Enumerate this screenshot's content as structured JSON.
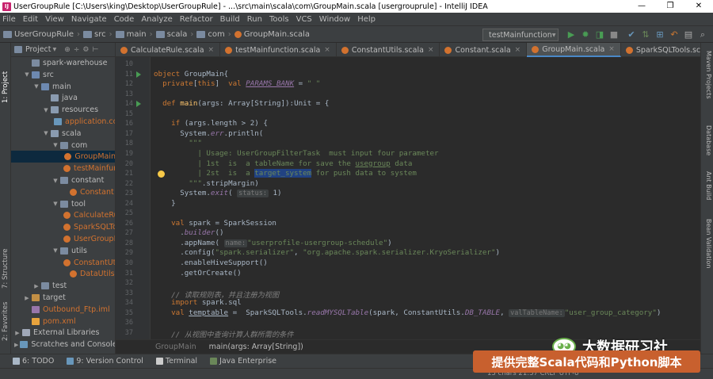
{
  "window": {
    "title": "UserGroupRule [C:\\Users\\king\\Desktop\\UserGroupRule] - ...\\src\\main\\scala\\com\\GroupMain.scala [usergrouprule] - IntelliJ IDEA",
    "controls": [
      "—",
      "❐",
      "✕"
    ]
  },
  "menu": [
    "File",
    "Edit",
    "View",
    "Navigate",
    "Code",
    "Analyze",
    "Refactor",
    "Build",
    "Run",
    "Tools",
    "VCS",
    "Window",
    "Help"
  ],
  "breadcrumb": [
    "UserGroupRule",
    "src",
    "main",
    "scala",
    "com",
    "GroupMain.scala"
  ],
  "run_config": "testMainfunction",
  "toolbar_icons": [
    "run-icon",
    "debug-icon",
    "coverage-icon",
    "profile-icon",
    "stop-icon",
    "build-icon",
    "vcs-icon",
    "structure-icon",
    "back-icon",
    "settings-icon"
  ],
  "left_tool_windows": [
    "1: Project",
    "7: Structure",
    "2: Favorites"
  ],
  "right_tool_windows": [
    "Maven Projects",
    "Database",
    "Ant Build",
    "Bean Validation"
  ],
  "project": {
    "header": "Project",
    "items": [
      {
        "label": "spark-warehouse",
        "indent": 1,
        "kind": "folder",
        "arrow": "",
        "color": "#bbbbbb"
      },
      {
        "label": "src",
        "indent": 1,
        "kind": "folder",
        "arrow": "▼",
        "color": "#bbbbbb"
      },
      {
        "label": "main",
        "indent": 2,
        "kind": "folder",
        "arrow": "▼",
        "color": "#bbbbbb"
      },
      {
        "label": "java",
        "indent": 3,
        "kind": "folder",
        "arrow": "",
        "color": "#bbbbbb"
      },
      {
        "label": "resources",
        "indent": 3,
        "kind": "folder",
        "arrow": "▼",
        "color": "#bbbbbb"
      },
      {
        "label": "application.conf",
        "indent": 4,
        "kind": "cfg",
        "arrow": "",
        "color": "#d2722f"
      },
      {
        "label": "scala",
        "indent": 3,
        "kind": "folder",
        "arrow": "▼",
        "color": "#bbbbbb"
      },
      {
        "label": "com",
        "indent": 4,
        "kind": "folder",
        "arrow": "▼",
        "color": "#bbbbbb"
      },
      {
        "label": "GroupMain",
        "indent": 5,
        "kind": "scala",
        "arrow": "",
        "color": "#d2722f",
        "selected": true
      },
      {
        "label": "testMainfunction",
        "indent": 5,
        "kind": "scala",
        "arrow": "",
        "color": "#d2722f"
      },
      {
        "label": "constant",
        "indent": 4,
        "kind": "folder",
        "arrow": "▼",
        "color": "#bbbbbb"
      },
      {
        "label": "Constant",
        "indent": 5,
        "kind": "scala",
        "arrow": "",
        "color": "#d2722f"
      },
      {
        "label": "tool",
        "indent": 4,
        "kind": "folder",
        "arrow": "▼",
        "color": "#bbbbbb"
      },
      {
        "label": "CalculateRule",
        "indent": 5,
        "kind": "scala",
        "arrow": "",
        "color": "#d2722f"
      },
      {
        "label": "SparkSQLTools",
        "indent": 5,
        "kind": "scala",
        "arrow": "",
        "color": "#d2722f"
      },
      {
        "label": "UserGroupRule",
        "indent": 5,
        "kind": "scala",
        "arrow": "",
        "color": "#d2722f"
      },
      {
        "label": "utils",
        "indent": 4,
        "kind": "folder",
        "arrow": "▼",
        "color": "#bbbbbb"
      },
      {
        "label": "ConstantUtils",
        "indent": 5,
        "kind": "scala",
        "arrow": "",
        "color": "#d2722f"
      },
      {
        "label": "DataUtils",
        "indent": 5,
        "kind": "scala",
        "arrow": "",
        "color": "#d2722f"
      },
      {
        "label": "test",
        "indent": 2,
        "kind": "folder",
        "arrow": "▶",
        "color": "#bbbbbb"
      },
      {
        "label": "target",
        "indent": 1,
        "kind": "folder",
        "arrow": "▶",
        "color": "#bbbbbb"
      },
      {
        "label": "Outbound_Ftp.iml",
        "indent": 1,
        "kind": "iml",
        "arrow": "",
        "color": "#d2722f"
      },
      {
        "label": "pom.xml",
        "indent": 1,
        "kind": "xml",
        "arrow": "",
        "color": "#d2722f"
      },
      {
        "label": "External Libraries",
        "indent": 0,
        "kind": "lib",
        "arrow": "▶",
        "color": "#bbbbbb"
      },
      {
        "label": "Scratches and Consoles",
        "indent": 0,
        "kind": "scratch",
        "arrow": "▶",
        "color": "#bbbbbb"
      }
    ]
  },
  "tabs": [
    {
      "label": "CalculateRule.scala",
      "active": false
    },
    {
      "label": "testMainfunction.scala",
      "active": false
    },
    {
      "label": "ConstantUtils.scala",
      "active": false
    },
    {
      "label": "Constant.scala",
      "active": false
    },
    {
      "label": "GroupMain.scala",
      "active": true
    },
    {
      "label": "SparkSQLTools.scala",
      "active": false
    }
  ],
  "code": {
    "lines": [
      {
        "n": "10",
        "segs": []
      },
      {
        "n": "11",
        "segs": [
          [
            "kw",
            "object "
          ],
          [
            "",
            "GroupMain{"
          ]
        ]
      },
      {
        "n": "12",
        "segs": [
          [
            "",
            "  "
          ],
          [
            "kw",
            "private"
          ],
          [
            "",
            "["
          ],
          [
            "kw",
            "this"
          ],
          [
            "",
            "]  "
          ],
          [
            "kw",
            "val "
          ],
          [
            "it und",
            "PARAMS_BANK"
          ],
          [
            "",
            " = "
          ],
          [
            "str",
            "\" \""
          ]
        ]
      },
      {
        "n": "13",
        "segs": []
      },
      {
        "n": "14",
        "segs": [
          [
            "",
            "  "
          ],
          [
            "kw",
            "def "
          ],
          [
            "fn",
            "main"
          ],
          [
            "",
            "(args: Array["
          ],
          [
            "",
            "String"
          ],
          [
            "",
            "]):"
          ],
          [
            "",
            "Unit"
          ],
          [
            "",
            " = {"
          ]
        ]
      },
      {
        "n": "15",
        "segs": []
      },
      {
        "n": "16",
        "segs": [
          [
            "",
            "    "
          ],
          [
            "kw",
            "if "
          ],
          [
            "",
            "(args.length > 2) {"
          ]
        ]
      },
      {
        "n": "17",
        "segs": [
          [
            "",
            "      System."
          ],
          [
            "it",
            "err"
          ],
          [
            "",
            ".println("
          ]
        ]
      },
      {
        "n": "18",
        "segs": [
          [
            "",
            "        "
          ],
          [
            "str",
            "\"\"\""
          ]
        ]
      },
      {
        "n": "19",
        "segs": [
          [
            "str",
            "          | Usage: UserGroupFilterTask  must input four parameter"
          ]
        ]
      },
      {
        "n": "20",
        "segs": [
          [
            "str",
            "          | 1st  is  a tableName for save the "
          ],
          [
            "str und",
            "usegroup"
          ],
          [
            "str",
            " data"
          ]
        ]
      },
      {
        "n": "21",
        "segs": [
          [
            "str",
            "          | 2st  is  a "
          ],
          [
            "str selx",
            "target_system"
          ],
          [
            "str",
            " for push data to system"
          ]
        ]
      },
      {
        "n": "22",
        "segs": [
          [
            "",
            "        "
          ],
          [
            "str",
            "\"\"\""
          ],
          [
            "",
            ".stripMargin)"
          ]
        ]
      },
      {
        "n": "23",
        "segs": [
          [
            "",
            "      System."
          ],
          [
            "it",
            "exit"
          ],
          [
            "",
            "( "
          ],
          [
            "hint",
            "status:"
          ],
          [
            "",
            " 1)"
          ]
        ]
      },
      {
        "n": "24",
        "segs": [
          [
            "",
            "    }"
          ]
        ]
      },
      {
        "n": "25",
        "segs": []
      },
      {
        "n": "26",
        "segs": [
          [
            "",
            "    "
          ],
          [
            "kw",
            "val "
          ],
          [
            "",
            "spark = SparkSession"
          ]
        ]
      },
      {
        "n": "27",
        "segs": [
          [
            "",
            "      ."
          ],
          [
            "it",
            "builder"
          ],
          [
            "",
            "()"
          ]
        ]
      },
      {
        "n": "28",
        "segs": [
          [
            "",
            "      .appName( "
          ],
          [
            "hint",
            "name:"
          ],
          [
            " ",
            ""
          ],
          [
            "str",
            "\"userprofile-usergroup-schedule\""
          ],
          [
            "",
            ")"
          ]
        ]
      },
      {
        "n": "29",
        "segs": [
          [
            "",
            "      .config("
          ],
          [
            "str",
            "\"spark.serializer\""
          ],
          [
            "",
            ", "
          ],
          [
            "str",
            "\"org.apache.spark.serializer.KryoSerializer\""
          ],
          [
            "",
            ")"
          ]
        ]
      },
      {
        "n": "30",
        "segs": [
          [
            "",
            "      .enableHiveSupport()"
          ]
        ]
      },
      {
        "n": "31",
        "segs": [
          [
            "",
            "      .getOrCreate()"
          ]
        ]
      },
      {
        "n": "32",
        "segs": []
      },
      {
        "n": "33",
        "segs": [
          [
            "cm",
            "    // 读取规则表，并且注册为视图"
          ]
        ]
      },
      {
        "n": "34",
        "segs": [
          [
            "",
            "    "
          ],
          [
            "kw",
            "import "
          ],
          [
            "",
            "spark.sql"
          ]
        ]
      },
      {
        "n": "35",
        "segs": [
          [
            "",
            "    "
          ],
          [
            "kw",
            "val "
          ],
          [
            "und",
            "temptable"
          ],
          [
            "",
            " =  SparkSQLTools."
          ],
          [
            "it",
            "readMYSQLTable"
          ],
          [
            "",
            "(spark, ConstantUtils."
          ],
          [
            "it",
            "DB_TABLE"
          ],
          [
            "",
            ", "
          ],
          [
            "hint",
            "valTableName:"
          ],
          [
            " ",
            ""
          ],
          [
            "str",
            "\"user_group_category\""
          ],
          [
            "",
            ")"
          ]
        ]
      },
      {
        "n": "36",
        "segs": []
      },
      {
        "n": "37",
        "segs": [
          [
            "cm",
            "    // 从视图中查询计算人群所需的条件"
          ]
        ]
      }
    ]
  },
  "editor_breadcrumb": [
    "GroupMain",
    "main(args: Array[String])"
  ],
  "bottom_tools": [
    {
      "label": "6: TODO",
      "icon": "todo-icon",
      "color": "#a9b7c6"
    },
    {
      "label": "9: Version Control",
      "icon": "vcs-icon",
      "color": "#6897bb"
    },
    {
      "label": "Terminal",
      "icon": "terminal-icon",
      "color": "#cccccc"
    },
    {
      "label": "Java Enterprise",
      "icon": "java-enterprise-icon",
      "color": "#6a8759"
    }
  ],
  "status": "13 chars   21:37   CRLF   UTF-8",
  "watermark": {
    "text": "大数据研习社",
    "icon": "wechat-icon"
  },
  "promo": "提供完整Scala代码和Python脚本"
}
